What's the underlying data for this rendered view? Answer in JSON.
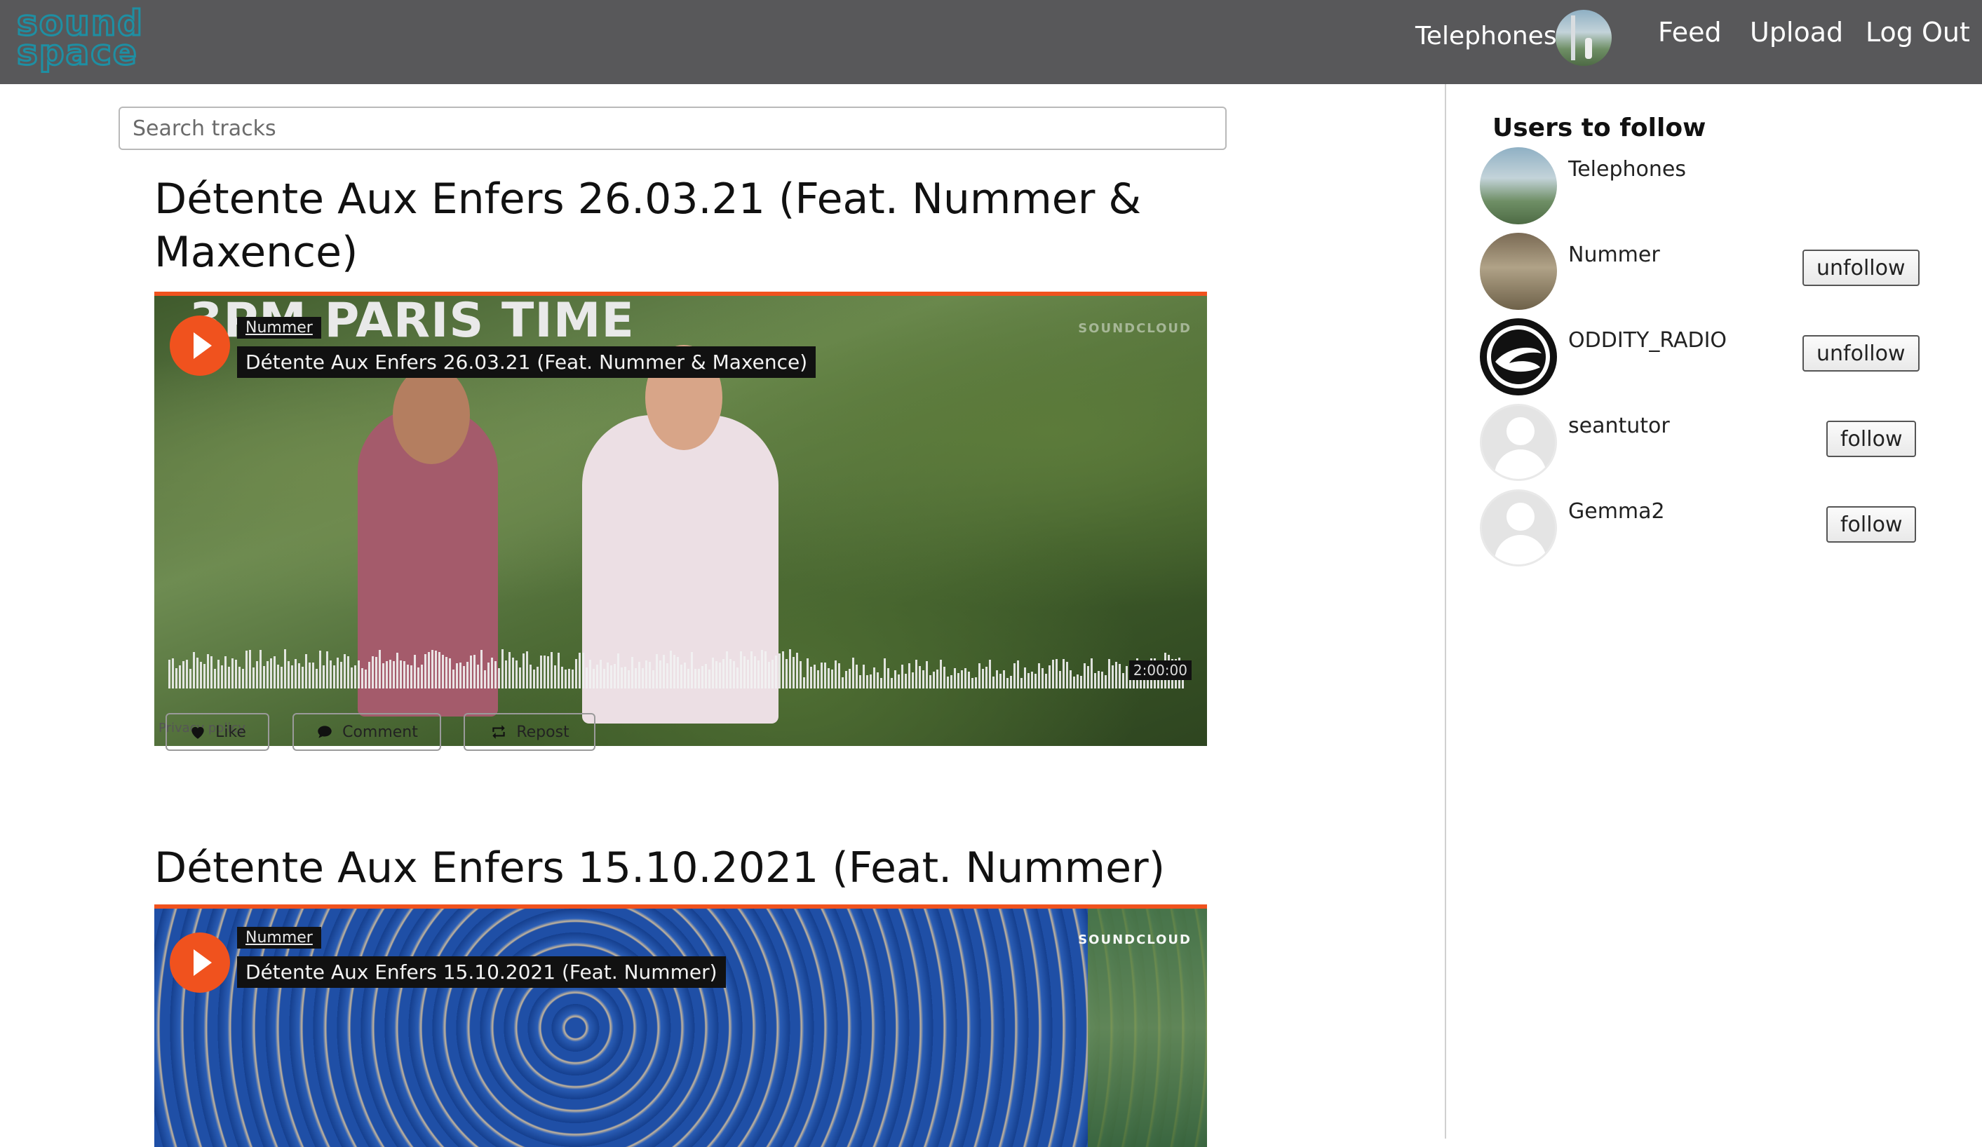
{
  "header": {
    "logo_line1": "sound",
    "logo_line2": "space",
    "username": "Telephones",
    "nav": {
      "feed": "Feed",
      "upload": "Upload",
      "logout": "Log Out"
    }
  },
  "search": {
    "placeholder": "Search tracks",
    "value": ""
  },
  "tracks": [
    {
      "title": "Détente Aux Enfers 26.03.21 (Feat. Nummer & Maxence)",
      "artist": "Nummer",
      "player_title": "Détente Aux Enfers 26.03.21 (Feat. Nummer & Maxence)",
      "artwork_text": "3PM PARIS TIME",
      "duration": "2:00:00",
      "privacy": "Privacy policy",
      "soundcloud": "SOUNDCLOUD"
    },
    {
      "title": "Détente Aux Enfers 15.10.2021 (Feat. Nummer)",
      "artist": "Nummer",
      "player_title": "Détente Aux Enfers 15.10.2021 (Feat. Nummer)",
      "soundcloud": "SOUNDCLOUD"
    }
  ],
  "actions": {
    "like": "Like",
    "comment": "Comment",
    "repost": "Repost"
  },
  "sidebar": {
    "title": "Users to follow",
    "users": [
      {
        "name": "Telephones",
        "button": ""
      },
      {
        "name": "Nummer",
        "button": "unfollow"
      },
      {
        "name": "ODDITY_RADIO",
        "button": "unfollow"
      },
      {
        "name": "seantutor",
        "button": "follow"
      },
      {
        "name": "Gemma2",
        "button": "follow"
      }
    ]
  },
  "colors": {
    "navbar": "#58585a",
    "soundcloud_orange": "#f0521e",
    "logo": "#1e8fa3"
  }
}
